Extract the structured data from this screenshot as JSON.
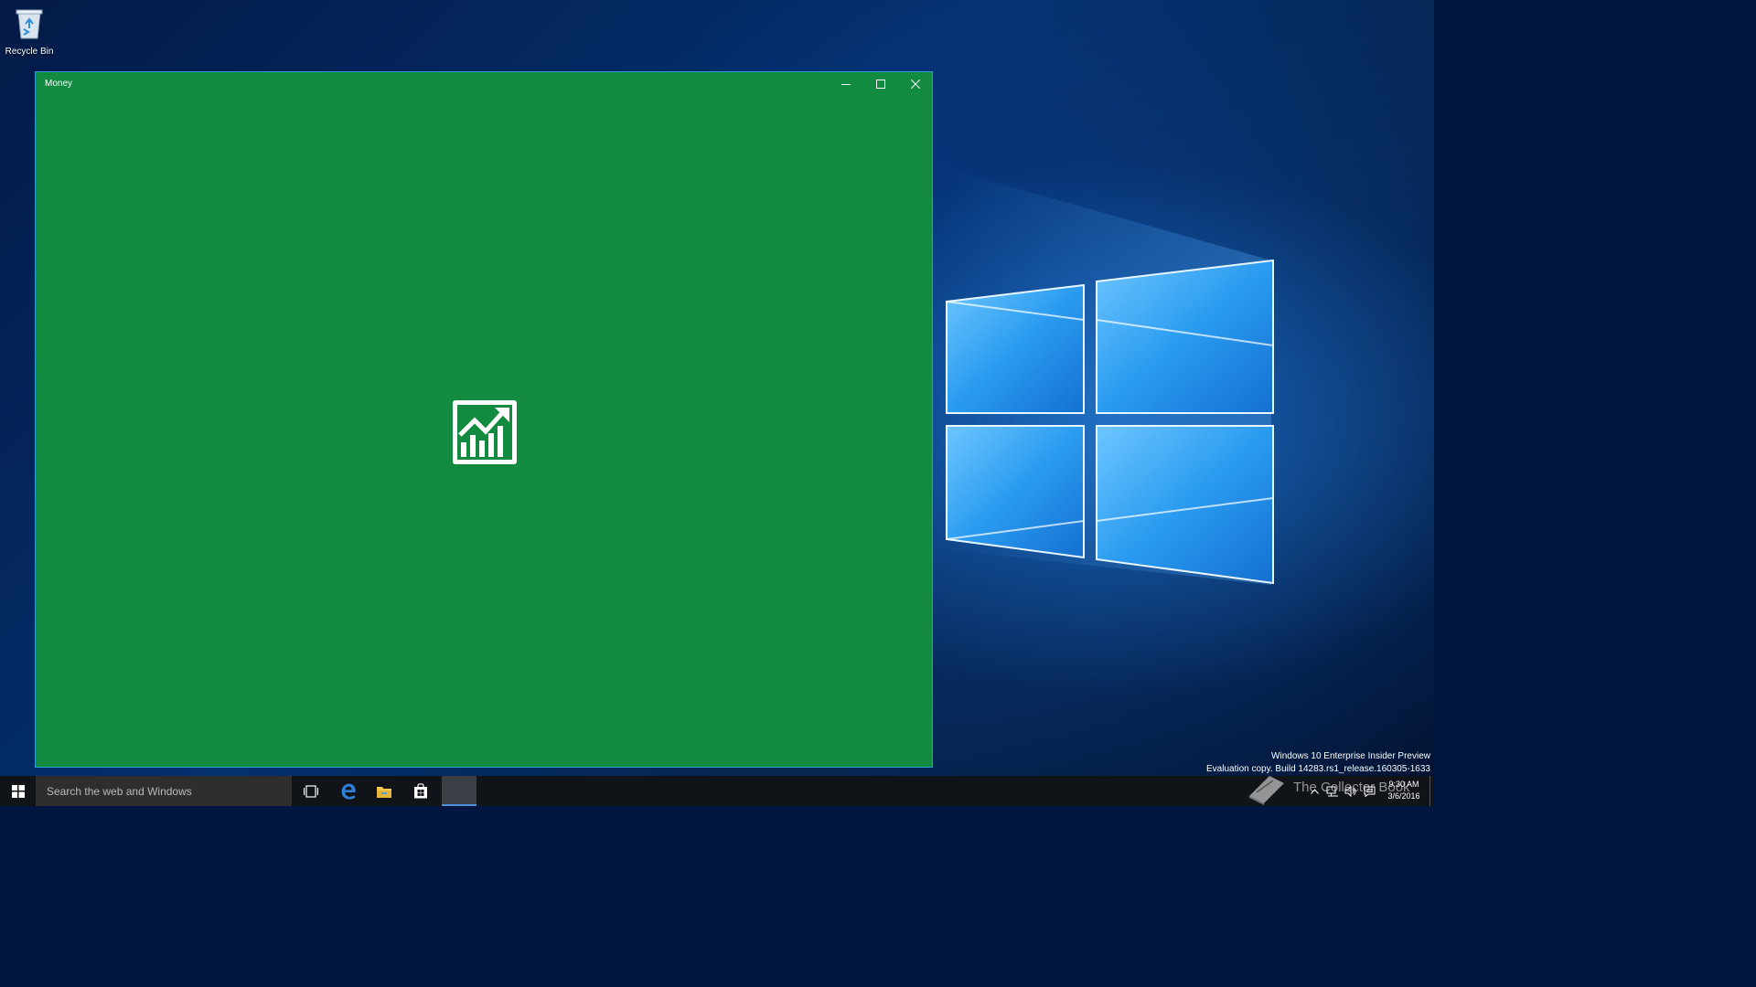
{
  "desktop": {
    "recycle_bin_label": "Recycle Bin"
  },
  "window": {
    "title": "Money",
    "app_icon": "stock-chart-icon",
    "background_color": "#128a3f",
    "border_color": "#2a9dd4"
  },
  "watermark": {
    "line1": "Windows 10 Enterprise Insider Preview",
    "line2": "Evaluation copy. Build 14283.rs1_release.160305-1633"
  },
  "overlay_brand": {
    "text": "The Collector Book"
  },
  "taskbar": {
    "search_placeholder": "Search the web and Windows",
    "clock_time": "9:30 AM",
    "clock_date": "3/6/2016"
  },
  "colors": {
    "taskbar": "#101317",
    "search_box": "#2e2e2e",
    "edge_blue": "#2f7fd6",
    "explorer_yellow": "#f3c64c"
  }
}
